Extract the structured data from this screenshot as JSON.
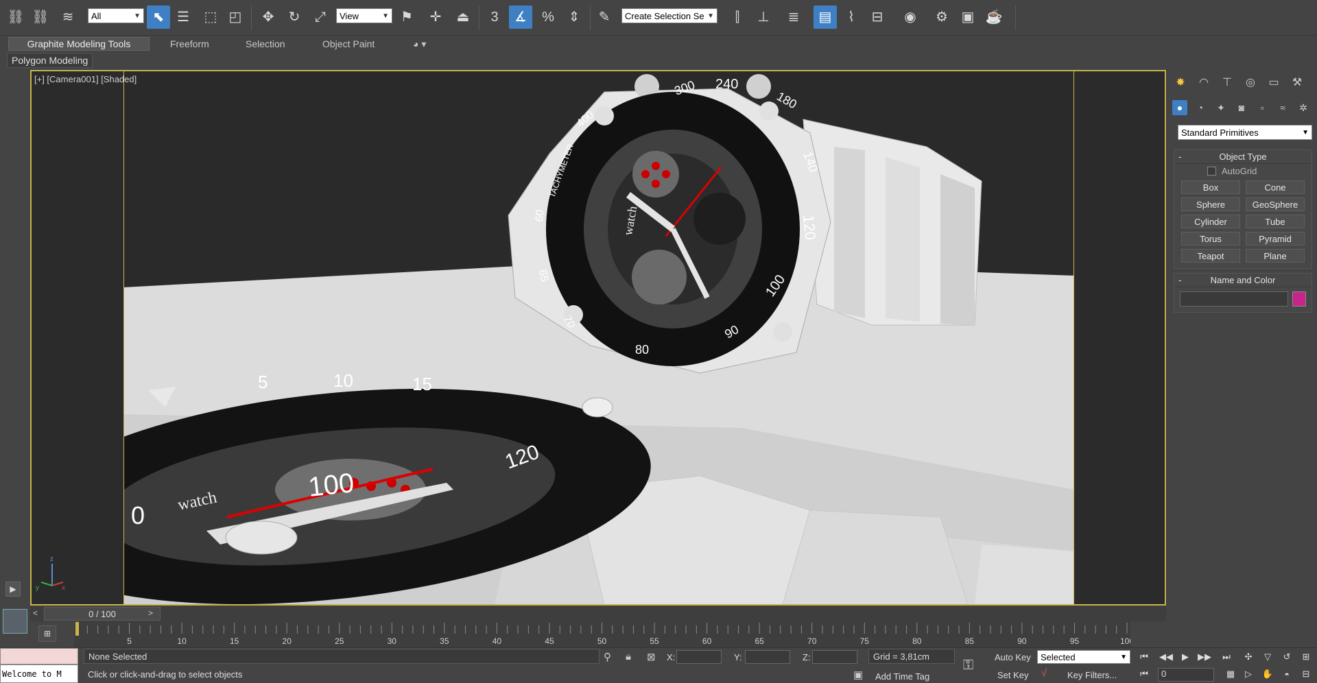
{
  "toolbar": {
    "selection_filter": "All",
    "reference_coord": "View",
    "named_selection_placeholder": "Create Selection Se",
    "snap_label": "3",
    "percent_snap_label": "%"
  },
  "ribbon": {
    "tabs": [
      "Graphite Modeling Tools",
      "Freeform",
      "Selection",
      "Object Paint"
    ],
    "panel_label": "Polygon Modeling"
  },
  "viewport": {
    "label": "[+] [Camera001] [Shaded]",
    "axis_x": "x",
    "axis_y": "y",
    "axis_z": "z"
  },
  "watch_dial": {
    "brand": "watch",
    "bezel_numbers": [
      "300",
      "240",
      "180",
      "140",
      "120",
      "100",
      "90",
      "80",
      "70",
      "65",
      "60",
      "400",
      "500"
    ],
    "bezel_text": "TACHYMETER",
    "front_numbers": [
      "5",
      "10",
      "15",
      "120",
      "100",
      "0"
    ]
  },
  "command_panel": {
    "category_dropdown": "Standard Primitives",
    "object_type": {
      "title": "Object Type",
      "autogrid_label": "AutoGrid",
      "buttons": [
        "Box",
        "Cone",
        "Sphere",
        "GeoSphere",
        "Cylinder",
        "Tube",
        "Torus",
        "Pyramid",
        "Teapot",
        "Plane"
      ]
    },
    "name_and_color": {
      "title": "Name and Color",
      "swatch_color": "#c8258a"
    }
  },
  "timeline": {
    "frame_display": "0 / 100",
    "ticks": [
      "5",
      "10",
      "15",
      "20",
      "25",
      "30",
      "35",
      "40",
      "45",
      "50",
      "55",
      "60",
      "65",
      "70",
      "75",
      "80",
      "85",
      "90",
      "95",
      "100"
    ]
  },
  "status": {
    "selection_text": "None Selected",
    "prompt_text": "Click or click-and-drag to select objects",
    "maxscript_text": "Welcome to M",
    "x_label": "X:",
    "y_label": "Y:",
    "z_label": "Z:",
    "grid_text": "Grid = 3,81cm",
    "add_time_tag": "Add Time Tag",
    "auto_key": "Auto Key",
    "set_key": "Set Key",
    "key_mode_select": "Selected",
    "key_filters": "Key Filters...",
    "current_frame": "0"
  },
  "colors": {
    "accent_blue": "#3f7fc4",
    "viewport_border": "#c9b44a",
    "panel_bg": "#444444"
  }
}
